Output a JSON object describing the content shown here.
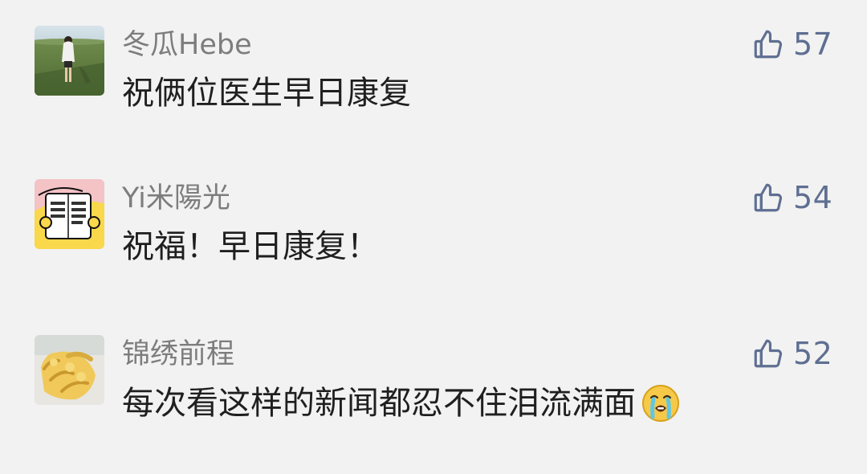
{
  "comments": [
    {
      "name": "冬瓜Hebe",
      "text": "祝俩位医生早日康复",
      "likes": "57",
      "avatar_icon": "girl-in-field-photo",
      "emoji": ""
    },
    {
      "name": "Yi米陽光",
      "text": "祝福！早日康复！",
      "likes": "54",
      "avatar_icon": "cartoon-reading-book",
      "emoji": ""
    },
    {
      "name": "锦绣前程",
      "text": "每次看这样的新闻都忍不住泪流满面",
      "likes": "52",
      "avatar_icon": "banana-bunch-photo",
      "emoji": "loudly-crying-face"
    }
  ],
  "icons": {
    "like": "thumbs-up-icon"
  },
  "colors": {
    "background": "#f2f2f2",
    "name": "#7d7d7d",
    "text": "#1f1f1f",
    "like": "#5f6f92"
  }
}
